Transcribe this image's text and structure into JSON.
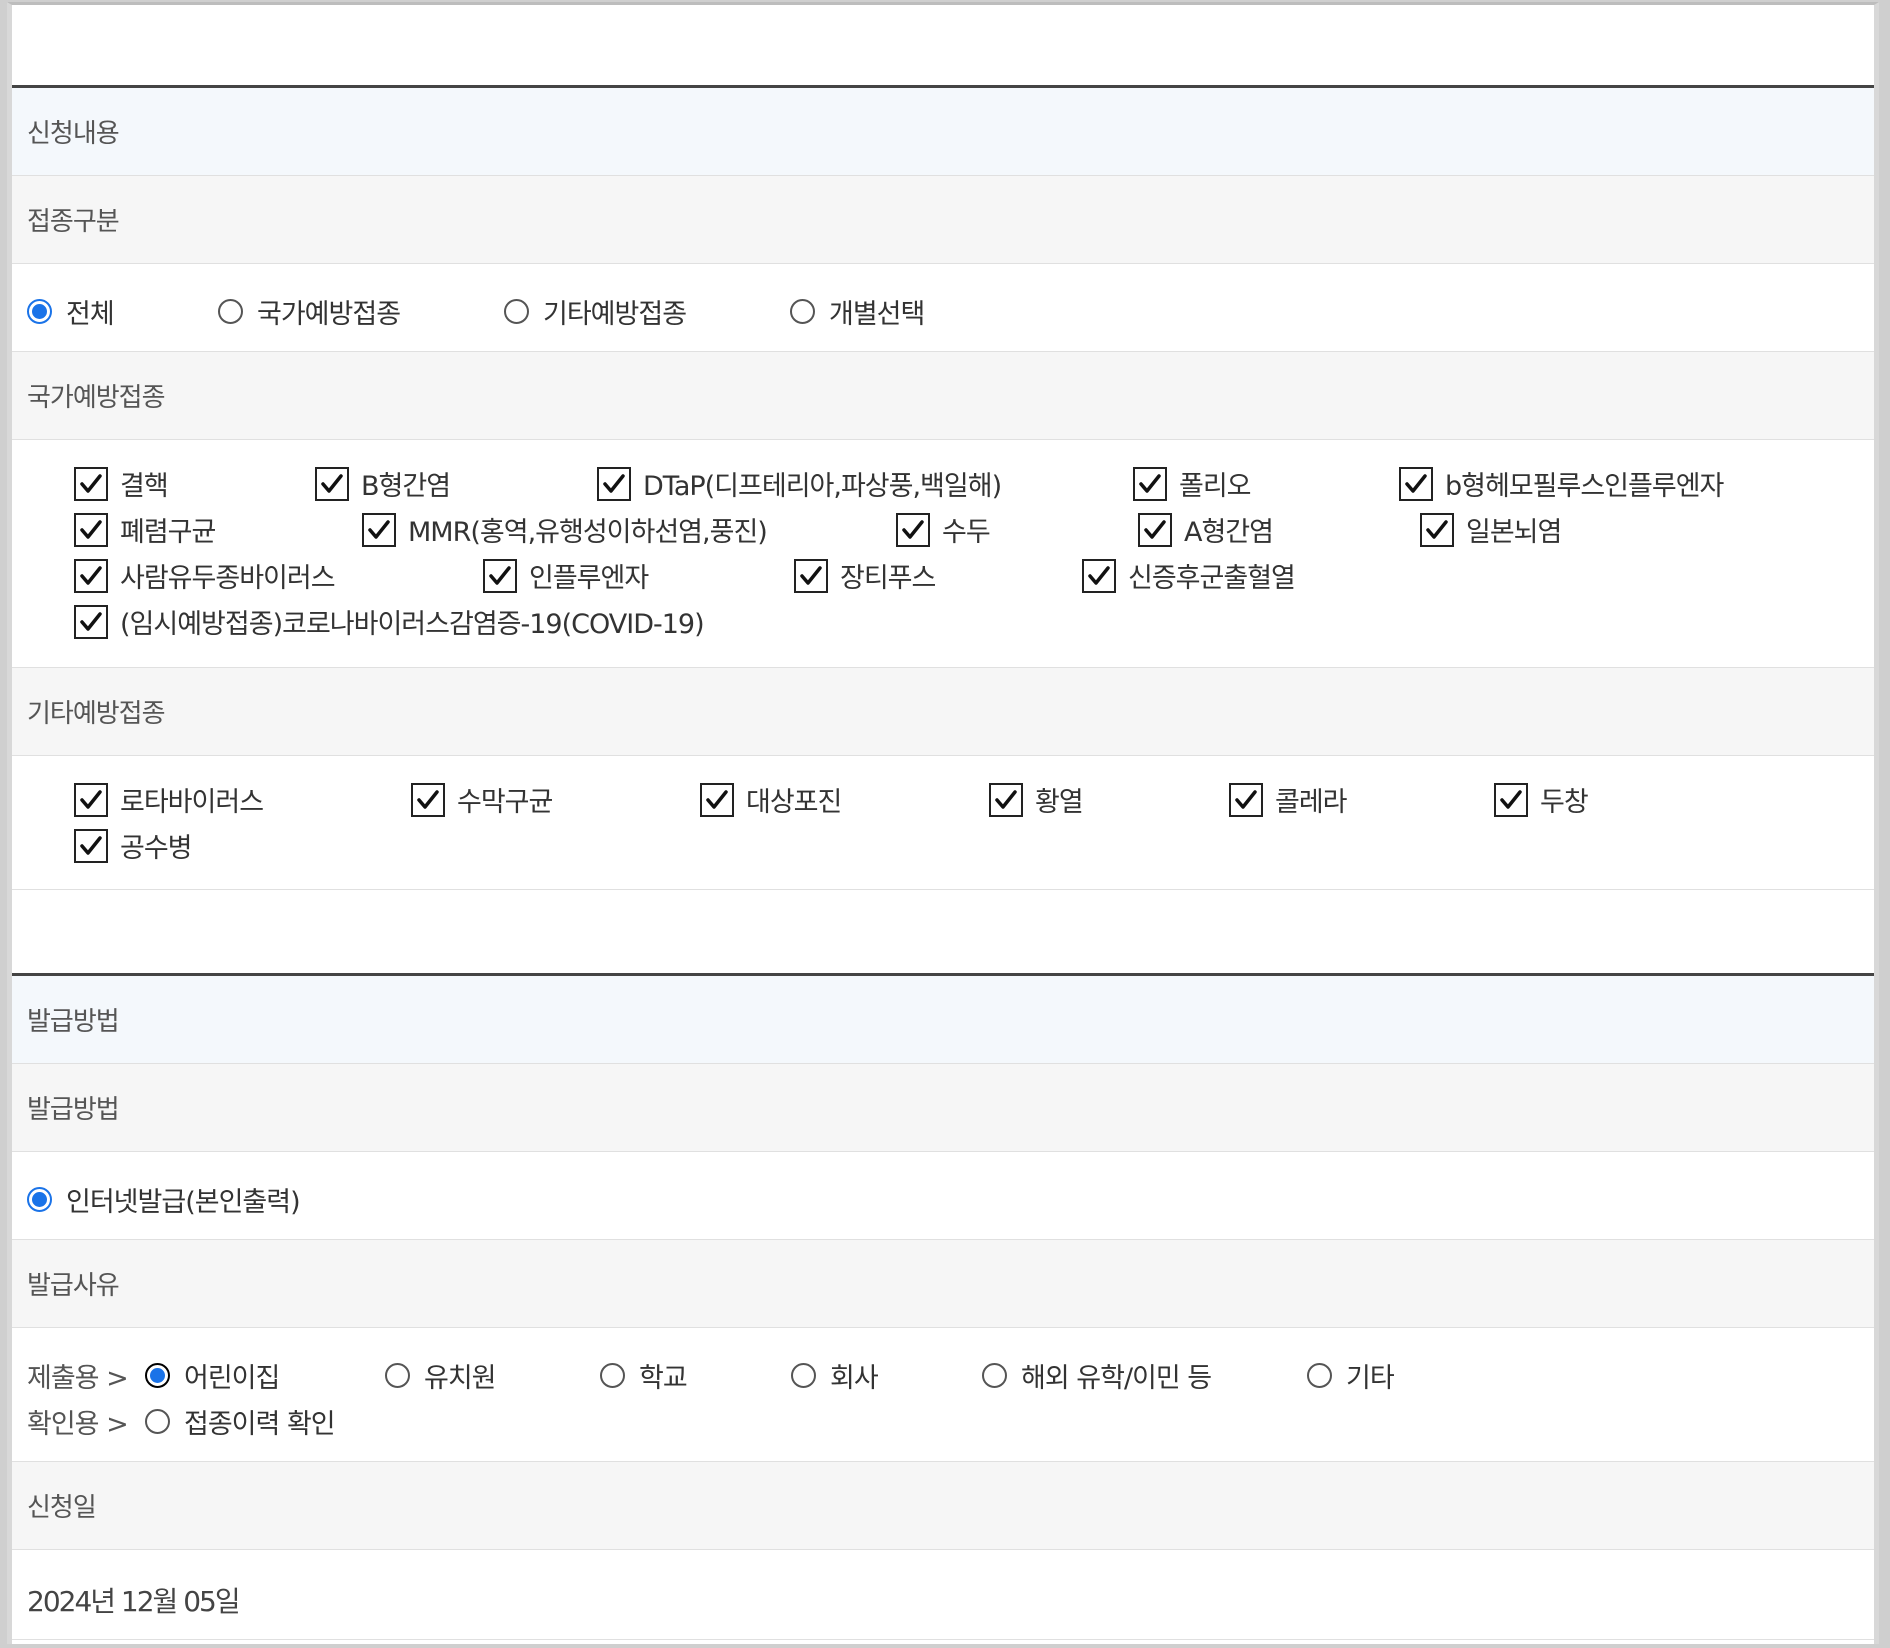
{
  "section1": {
    "title": "신청내용"
  },
  "vaccination_type": {
    "label": "접종구분",
    "options": [
      "전체",
      "국가예방접종",
      "기타예방접종",
      "개별선택"
    ],
    "selected": "전체"
  },
  "national": {
    "label": "국가예방접종",
    "items": [
      "결핵",
      "B형간염",
      "DTaP(디프테리아,파상풍,백일해)",
      "폴리오",
      "b형헤모필루스인플루엔자",
      "폐렴구균",
      "MMR(홍역,유행성이하선염,풍진)",
      "수두",
      "A형간염",
      "일본뇌염",
      "사람유두종바이러스",
      "인플루엔자",
      "장티푸스",
      "신증후군출혈열",
      "(임시예방접종)코로나바이러스감염증-19(COVID-19)"
    ]
  },
  "other": {
    "label": "기타예방접종",
    "items": [
      "로타바이러스",
      "수막구균",
      "대상포진",
      "황열",
      "콜레라",
      "두창",
      "공수병"
    ]
  },
  "section2": {
    "title": "발급방법"
  },
  "issue_method": {
    "label": "발급방법",
    "option": "인터넷발급(본인출력)"
  },
  "issue_reason": {
    "label": "발급사유",
    "submit_prefix": "제출용 >",
    "submit_options": [
      "어린이집",
      "유치원",
      "학교",
      "회사",
      "해외 유학/이민 등",
      "기타"
    ],
    "submit_selected": "어린이집",
    "confirm_prefix": "확인용 >",
    "confirm_option": "접종이력 확인"
  },
  "apply_date": {
    "label": "신청일",
    "value": "2024년 12월 05일"
  },
  "colors": {
    "accent": "#1a73e8",
    "section_bg": "#f4f8fc",
    "label_bg": "#f6f6f6"
  }
}
